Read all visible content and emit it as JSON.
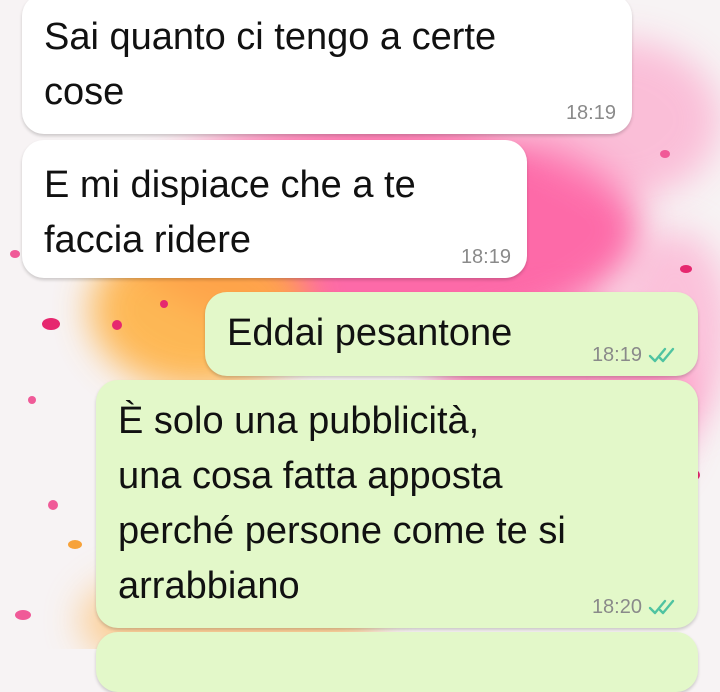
{
  "theme": {
    "incoming_bg": "#ffffff",
    "outgoing_bg": "#e3f8c9",
    "tick_color": "#4fc3a1",
    "wallpaper_accent": "#ef2f86"
  },
  "messages": [
    {
      "direction": "incoming",
      "text": "Sai quanto ci tengo a certe\ncose",
      "time": "18:19"
    },
    {
      "direction": "incoming",
      "text": "E mi dispiace che a te\nfaccia ridere",
      "time": "18:19"
    },
    {
      "direction": "outgoing",
      "text": "Eddai pesantone",
      "time": "18:19",
      "status_icon": "double-check-icon"
    },
    {
      "direction": "outgoing",
      "text": "È solo una pubblicità,\nuna cosa fatta apposta\nperché persone come te si\narrabbiano",
      "time": "18:20",
      "status_icon": "double-check-icon"
    }
  ]
}
